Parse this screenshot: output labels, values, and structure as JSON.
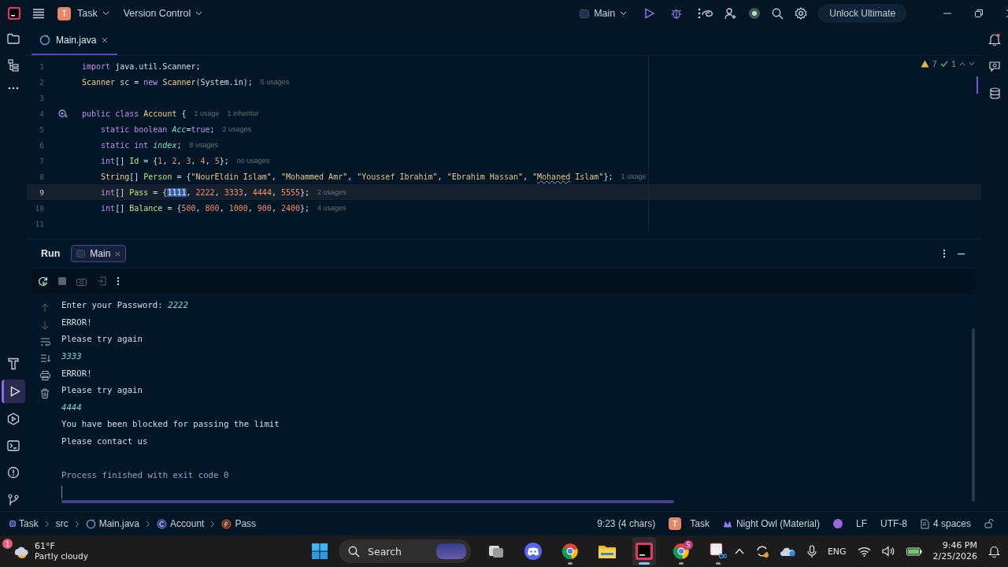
{
  "title_bar": {
    "project_badge": "T",
    "project": "Task",
    "vcs": "Version Control",
    "run_config": "Main",
    "unlock_button": "Unlock Ultimate"
  },
  "editor_tabs": [
    {
      "label": "Main.java",
      "selected": true
    }
  ],
  "inspections": {
    "warnings": "7",
    "checks": "1"
  },
  "code_lines": [
    {
      "number": "1",
      "current": false,
      "implemented": false,
      "tokens": [
        {
          "t": "import ",
          "kind": "kw"
        },
        {
          "t": "java.util.Scanner;",
          "kind": "plain"
        }
      ]
    },
    {
      "number": "2",
      "current": false,
      "implemented": false,
      "tokens": [
        {
          "t": "Scanner",
          "kind": "type"
        },
        {
          "t": " sc = ",
          "kind": "plain"
        },
        {
          "t": "new ",
          "kind": "kw"
        },
        {
          "t": "Scanner",
          "kind": "type"
        },
        {
          "t": "(System.in);",
          "kind": "plain"
        }
      ],
      "hints": [
        "5 usages"
      ]
    },
    {
      "number": "3",
      "current": false,
      "implemented": false
    },
    {
      "number": "4",
      "current": false,
      "implemented": true,
      "tokens": [
        {
          "t": "public class ",
          "kind": "kw"
        },
        {
          "t": "Account",
          "kind": "type"
        },
        {
          "t": " {",
          "kind": "plain"
        }
      ],
      "hints": [
        "1 usage",
        "1 inheritor"
      ]
    },
    {
      "number": "5",
      "current": false,
      "implemented": false,
      "tokens": [
        {
          "t": "    static boolean ",
          "kind": "kw"
        },
        {
          "t": "Acc",
          "kind": "static"
        },
        {
          "t": "=",
          "kind": "plain"
        },
        {
          "t": "true",
          "kind": "kw"
        },
        {
          "t": ";",
          "kind": "plain"
        }
      ],
      "hints": [
        "2 usages"
      ]
    },
    {
      "number": "6",
      "current": false,
      "implemented": false,
      "tokens": [
        {
          "t": "    static int ",
          "kind": "kw"
        },
        {
          "t": "index",
          "kind": "static"
        },
        {
          "t": ";",
          "kind": "plain"
        }
      ],
      "hints": [
        "8 usages"
      ]
    },
    {
      "number": "7",
      "current": false,
      "implemented": false,
      "tokens": [
        {
          "t": "    int",
          "kind": "kw"
        },
        {
          "t": "[] ",
          "kind": "plain"
        },
        {
          "t": "Id",
          "kind": "field"
        },
        {
          "t": " = {",
          "kind": "plain"
        },
        {
          "t": "1",
          "kind": "num"
        },
        {
          "t": ", ",
          "kind": "plain"
        },
        {
          "t": "2",
          "kind": "num"
        },
        {
          "t": ", ",
          "kind": "plain"
        },
        {
          "t": "3",
          "kind": "num"
        },
        {
          "t": ", ",
          "kind": "plain"
        },
        {
          "t": "4",
          "kind": "num"
        },
        {
          "t": ", ",
          "kind": "plain"
        },
        {
          "t": "5",
          "kind": "num"
        },
        {
          "t": "};",
          "kind": "plain"
        }
      ],
      "hints": [
        "no usages"
      ]
    },
    {
      "number": "8",
      "current": false,
      "implemented": false,
      "tokens": [
        {
          "t": "    String",
          "kind": "type"
        },
        {
          "t": "[] ",
          "kind": "plain"
        },
        {
          "t": "Person",
          "kind": "field"
        },
        {
          "t": " = {",
          "kind": "plain"
        },
        {
          "t": "\"NourEldin Islam\"",
          "kind": "str"
        },
        {
          "t": ", ",
          "kind": "plain"
        },
        {
          "t": "\"Mohammed Amr\"",
          "kind": "str"
        },
        {
          "t": ", ",
          "kind": "plain"
        },
        {
          "t": "\"Youssef Ibrahim\"",
          "kind": "str"
        },
        {
          "t": ", ",
          "kind": "plain"
        },
        {
          "t": "\"Ebrahim Hassan\"",
          "kind": "str"
        },
        {
          "t": ", ",
          "kind": "plain"
        },
        {
          "t": "\"",
          "kind": "str"
        },
        {
          "t": "Mohaned",
          "kind": "typo"
        },
        {
          "t": " Islam\"",
          "kind": "str"
        },
        {
          "t": "};",
          "kind": "plain"
        }
      ],
      "hints": [
        "1 usage"
      ]
    },
    {
      "number": "9",
      "current": true,
      "implemented": false,
      "tokens": [
        {
          "t": "    int",
          "kind": "kw"
        },
        {
          "t": "[] ",
          "kind": "plain"
        },
        {
          "t": "Pass",
          "kind": "field"
        },
        {
          "t": " = {",
          "kind": "plain"
        },
        {
          "t": "1111",
          "kind": "selection"
        },
        {
          "t": ", ",
          "kind": "plain"
        },
        {
          "t": "2222",
          "kind": "num"
        },
        {
          "t": ", ",
          "kind": "plain"
        },
        {
          "t": "3333",
          "kind": "num"
        },
        {
          "t": ", ",
          "kind": "plain"
        },
        {
          "t": "4444",
          "kind": "num"
        },
        {
          "t": ", ",
          "kind": "plain"
        },
        {
          "t": "5555",
          "kind": "num"
        },
        {
          "t": "};",
          "kind": "plain"
        }
      ],
      "hints": [
        "2 usages"
      ]
    },
    {
      "number": "10",
      "current": false,
      "implemented": false,
      "tokens": [
        {
          "t": "    int",
          "kind": "kw"
        },
        {
          "t": "[] ",
          "kind": "plain"
        },
        {
          "t": "Balance",
          "kind": "field"
        },
        {
          "t": " = {",
          "kind": "plain"
        },
        {
          "t": "500",
          "kind": "num"
        },
        {
          "t": ", ",
          "kind": "plain"
        },
        {
          "t": "800",
          "kind": "num"
        },
        {
          "t": ", ",
          "kind": "plain"
        },
        {
          "t": "1000",
          "kind": "num"
        },
        {
          "t": ", ",
          "kind": "plain"
        },
        {
          "t": "900",
          "kind": "num"
        },
        {
          "t": ", ",
          "kind": "plain"
        },
        {
          "t": "2400",
          "kind": "num"
        },
        {
          "t": "};",
          "kind": "plain"
        }
      ],
      "hints": [
        "4 usages"
      ]
    },
    {
      "number": "11",
      "current": false,
      "implemented": false
    }
  ],
  "run_panel": {
    "title": "Run",
    "tabs": [
      {
        "label": "Main",
        "selected": true
      }
    ]
  },
  "console_lines": [
    {
      "kind": "prompt",
      "text": "Enter your Password:",
      "input": "2222"
    },
    {
      "kind": "output",
      "text": "ERROR!"
    },
    {
      "kind": "output",
      "text": "Please try again"
    },
    {
      "kind": "input",
      "text": "3333"
    },
    {
      "kind": "output",
      "text": "ERROR!"
    },
    {
      "kind": "output",
      "text": "Please try again"
    },
    {
      "kind": "input",
      "text": "4444"
    },
    {
      "kind": "output",
      "text": "You have been blocked for passing the limit"
    },
    {
      "kind": "output",
      "text": "Please contact us"
    },
    {
      "kind": "exit",
      "text": "Process finished with exit code 0"
    }
  ],
  "breadcrumbs": [
    {
      "kind": "module",
      "label": "Task"
    },
    {
      "kind": "folder",
      "label": "src"
    },
    {
      "kind": "file",
      "label": "Main.java"
    },
    {
      "kind": "class",
      "label": "Account"
    },
    {
      "kind": "field",
      "label": "Pass"
    }
  ],
  "status_bar": {
    "position": "9:23 (4 chars)",
    "project_badge": "T",
    "project": "Task",
    "theme": "Night Owl (Material)",
    "line_separator": "LF",
    "encoding": "UTF-8",
    "indent": "4 spaces"
  },
  "taskbar": {
    "weather": {
      "badge": "1",
      "temperature": "61°F",
      "condition": "Partly cloudy"
    },
    "search_placeholder": "Search",
    "apps": [
      {
        "kind": "task-view",
        "active": false,
        "running": false
      },
      {
        "kind": "chat",
        "active": false,
        "running": false
      },
      {
        "kind": "browser",
        "active": false,
        "running": true
      },
      {
        "kind": "files",
        "active": false,
        "running": false
      },
      {
        "kind": "ide",
        "active": true,
        "running": true
      },
      {
        "kind": "browser",
        "active": false,
        "running": true,
        "badge": "S"
      },
      {
        "kind": "snipping",
        "active": false,
        "running": true
      }
    ],
    "language": "ENG",
    "time": "9:46 PM",
    "date": "2/25/2026"
  }
}
